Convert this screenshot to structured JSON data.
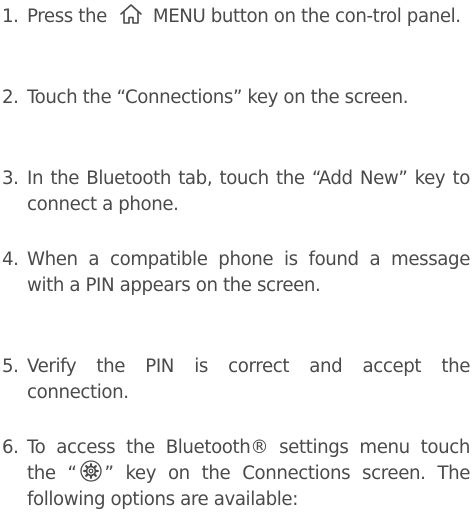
{
  "steps": [
    {
      "number": "1.",
      "before_icon": "Press the",
      "icon": "home-icon",
      "after_icon": "MENU button on the con-trol panel."
    },
    {
      "number": "2.",
      "text": "Touch the “Connections” key on the screen."
    },
    {
      "number": "3.",
      "text": "In the Bluetooth tab, touch the “Add New” key to connect a phone."
    },
    {
      "number": "4.",
      "text": "When a compatible phone is found a message with a PIN appears on the screen."
    },
    {
      "number": "5.",
      "text": "Verify the PIN is correct and accept the connection."
    },
    {
      "number": "6.",
      "before_icon": "To access the Bluetooth® settings menu touch the “",
      "icon": "settings-gear-icon",
      "after_icon": "” key on the Connections screen. The following options are available:"
    }
  ],
  "colors": {
    "text": "#4a4a4a"
  }
}
